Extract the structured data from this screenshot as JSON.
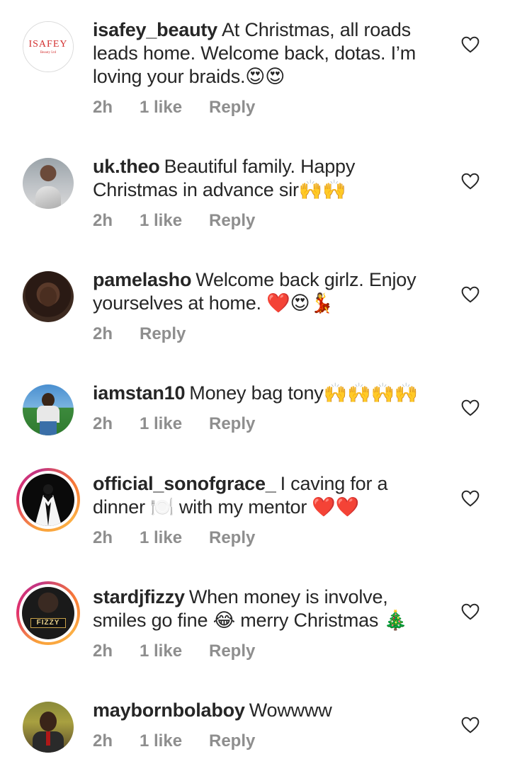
{
  "comments": [
    {
      "username": "isafey_beauty",
      "text": "At Christmas, all roads leads home. Welcome back, dotas. I’m loving your braids.😍😍",
      "time": "2h",
      "likes": "1 like",
      "reply": "Reply",
      "avatar_text": "ISAFEY",
      "avatar_subtext": "Beauty Ltd"
    },
    {
      "username": "uk.theo",
      "text": "Beautiful family. Happy Christmas in advance sir🙌🙌",
      "time": "2h",
      "likes": "1 like",
      "reply": "Reply"
    },
    {
      "username": "pamelasho",
      "text": "Welcome back girlz. Enjoy yourselves at home. ❤️😍💃",
      "time": "2h",
      "likes": "",
      "reply": "Reply"
    },
    {
      "username": "iamstan10",
      "text": "Money bag tony🙌🙌🙌🙌",
      "time": "2h",
      "likes": "1 like",
      "reply": "Reply"
    },
    {
      "username": "official_sonofgrace_",
      "text": "I caving for a dinner 🍽️ with my mentor ❤️❤️",
      "time": "2h",
      "likes": "1 like",
      "reply": "Reply"
    },
    {
      "username": "stardjfizzy",
      "text": "When money is involve, smiles go fine 😂 merry Christmas 🎄",
      "time": "2h",
      "likes": "1 like",
      "reply": "Reply",
      "avatar_text": "FIZZY"
    },
    {
      "username": "maybornbolaboy",
      "text": "Wowwww",
      "time": "2h",
      "likes": "1 like",
      "reply": "Reply"
    }
  ],
  "icons": {
    "heart": "heart-outline-icon"
  },
  "colors": {
    "muted": "#8e8e8e",
    "text": "#262626"
  }
}
